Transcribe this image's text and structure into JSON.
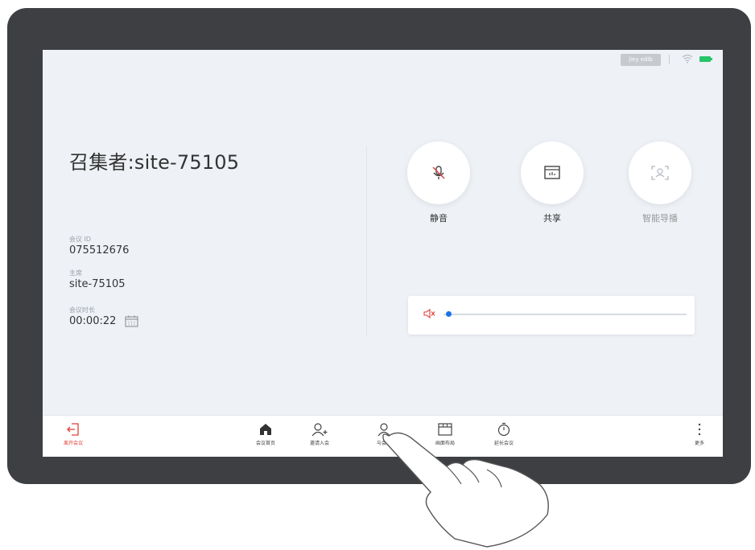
{
  "status_bar": {
    "user_tag": "jiey edib"
  },
  "meeting": {
    "host_title": "召集者:site-75105",
    "meeting_id_label": "会议 ID",
    "meeting_id": "075512676",
    "chair_label": "主席",
    "chair": "site-75105",
    "duration_label": "会议时长",
    "duration": "00:00:22"
  },
  "actions": [
    {
      "label": "静音",
      "icon": "mic-mute-icon"
    },
    {
      "label": "共享",
      "icon": "share-screen-icon"
    },
    {
      "label": "智能导播",
      "icon": "smart-director-icon"
    }
  ],
  "volume": {
    "level": 0.02
  },
  "toolbar": {
    "leave": "离开会议",
    "home": "会议首页",
    "invite": "邀请入会",
    "attendees": "与会者",
    "layout": "画面布局",
    "extend": "延长会议",
    "more": "更多"
  },
  "colors": {
    "leave_red": "#e0403a",
    "accent_blue": "#1a73e8",
    "battery_green": "#27c46a"
  }
}
